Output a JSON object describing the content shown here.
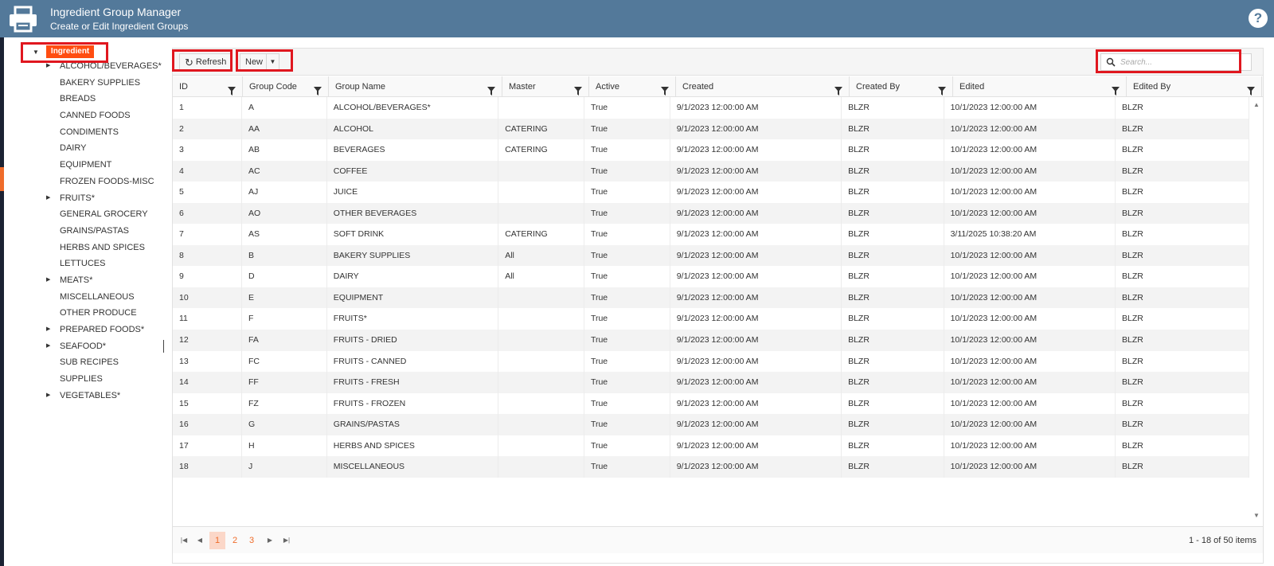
{
  "header": {
    "title": "Ingredient Group Manager",
    "subtitle": "Create or Edit Ingredient Groups",
    "help_label": "?",
    "icon": "printer-icon"
  },
  "tree": {
    "root_label": "Ingredient",
    "items": [
      {
        "label": "ALCOHOL/BEVERAGES*",
        "expandable": true
      },
      {
        "label": "BAKERY SUPPLIES",
        "expandable": false
      },
      {
        "label": "BREADS",
        "expandable": false
      },
      {
        "label": "CANNED FOODS",
        "expandable": false
      },
      {
        "label": "CONDIMENTS",
        "expandable": false
      },
      {
        "label": "DAIRY",
        "expandable": false
      },
      {
        "label": "EQUIPMENT",
        "expandable": false
      },
      {
        "label": "FROZEN FOODS-MISC",
        "expandable": false
      },
      {
        "label": "FRUITS*",
        "expandable": true
      },
      {
        "label": "GENERAL GROCERY",
        "expandable": false
      },
      {
        "label": "GRAINS/PASTAS",
        "expandable": false
      },
      {
        "label": "HERBS AND SPICES",
        "expandable": false
      },
      {
        "label": "LETTUCES",
        "expandable": false
      },
      {
        "label": "MEATS*",
        "expandable": true
      },
      {
        "label": "MISCELLANEOUS",
        "expandable": false
      },
      {
        "label": "OTHER PRODUCE",
        "expandable": false
      },
      {
        "label": "PREPARED FOODS*",
        "expandable": true
      },
      {
        "label": "SEAFOOD*",
        "expandable": true
      },
      {
        "label": "SUB RECIPES",
        "expandable": false
      },
      {
        "label": "SUPPLIES",
        "expandable": false
      },
      {
        "label": "VEGETABLES*",
        "expandable": true
      }
    ]
  },
  "toolbar": {
    "refresh_label": "Refresh",
    "new_label": "New",
    "search_placeholder": "Search..."
  },
  "grid": {
    "columns": [
      "ID",
      "Group Code",
      "Group Name",
      "Master",
      "Active",
      "Created",
      "Created By",
      "Edited",
      "Edited By"
    ],
    "rows": [
      [
        "1",
        "A",
        "ALCOHOL/BEVERAGES*",
        "",
        "True",
        "9/1/2023 12:00:00 AM",
        "BLZR",
        "10/1/2023 12:00:00 AM",
        "BLZR"
      ],
      [
        "2",
        "AA",
        "ALCOHOL",
        "CATERING",
        "True",
        "9/1/2023 12:00:00 AM",
        "BLZR",
        "10/1/2023 12:00:00 AM",
        "BLZR"
      ],
      [
        "3",
        "AB",
        "BEVERAGES",
        "CATERING",
        "True",
        "9/1/2023 12:00:00 AM",
        "BLZR",
        "10/1/2023 12:00:00 AM",
        "BLZR"
      ],
      [
        "4",
        "AC",
        "COFFEE",
        "",
        "True",
        "9/1/2023 12:00:00 AM",
        "BLZR",
        "10/1/2023 12:00:00 AM",
        "BLZR"
      ],
      [
        "5",
        "AJ",
        "JUICE",
        "",
        "True",
        "9/1/2023 12:00:00 AM",
        "BLZR",
        "10/1/2023 12:00:00 AM",
        "BLZR"
      ],
      [
        "6",
        "AO",
        "OTHER BEVERAGES",
        "",
        "True",
        "9/1/2023 12:00:00 AM",
        "BLZR",
        "10/1/2023 12:00:00 AM",
        "BLZR"
      ],
      [
        "7",
        "AS",
        "SOFT DRINK",
        "CATERING",
        "True",
        "9/1/2023 12:00:00 AM",
        "BLZR",
        "3/11/2025 10:38:20 AM",
        "BLZR"
      ],
      [
        "8",
        "B",
        "BAKERY SUPPLIES",
        "All",
        "True",
        "9/1/2023 12:00:00 AM",
        "BLZR",
        "10/1/2023 12:00:00 AM",
        "BLZR"
      ],
      [
        "9",
        "D",
        "DAIRY",
        "All",
        "True",
        "9/1/2023 12:00:00 AM",
        "BLZR",
        "10/1/2023 12:00:00 AM",
        "BLZR"
      ],
      [
        "10",
        "E",
        "EQUIPMENT",
        "",
        "True",
        "9/1/2023 12:00:00 AM",
        "BLZR",
        "10/1/2023 12:00:00 AM",
        "BLZR"
      ],
      [
        "11",
        "F",
        "FRUITS*",
        "",
        "True",
        "9/1/2023 12:00:00 AM",
        "BLZR",
        "10/1/2023 12:00:00 AM",
        "BLZR"
      ],
      [
        "12",
        "FA",
        "FRUITS - DRIED",
        "",
        "True",
        "9/1/2023 12:00:00 AM",
        "BLZR",
        "10/1/2023 12:00:00 AM",
        "BLZR"
      ],
      [
        "13",
        "FC",
        "FRUITS - CANNED",
        "",
        "True",
        "9/1/2023 12:00:00 AM",
        "BLZR",
        "10/1/2023 12:00:00 AM",
        "BLZR"
      ],
      [
        "14",
        "FF",
        "FRUITS - FRESH",
        "",
        "True",
        "9/1/2023 12:00:00 AM",
        "BLZR",
        "10/1/2023 12:00:00 AM",
        "BLZR"
      ],
      [
        "15",
        "FZ",
        "FRUITS - FROZEN",
        "",
        "True",
        "9/1/2023 12:00:00 AM",
        "BLZR",
        "10/1/2023 12:00:00 AM",
        "BLZR"
      ],
      [
        "16",
        "G",
        "GRAINS/PASTAS",
        "",
        "True",
        "9/1/2023 12:00:00 AM",
        "BLZR",
        "10/1/2023 12:00:00 AM",
        "BLZR"
      ],
      [
        "17",
        "H",
        "HERBS AND SPICES",
        "",
        "True",
        "9/1/2023 12:00:00 AM",
        "BLZR",
        "10/1/2023 12:00:00 AM",
        "BLZR"
      ],
      [
        "18",
        "J",
        "MISCELLANEOUS",
        "",
        "True",
        "9/1/2023 12:00:00 AM",
        "BLZR",
        "10/1/2023 12:00:00 AM",
        "BLZR"
      ]
    ]
  },
  "pager": {
    "pages": [
      "1",
      "2",
      "3"
    ],
    "current_page": "1",
    "info": "1 - 18 of 50 items"
  },
  "colors": {
    "header_bg": "#53799a",
    "accent": "#ef6c2a",
    "highlight": "#e0171f"
  }
}
